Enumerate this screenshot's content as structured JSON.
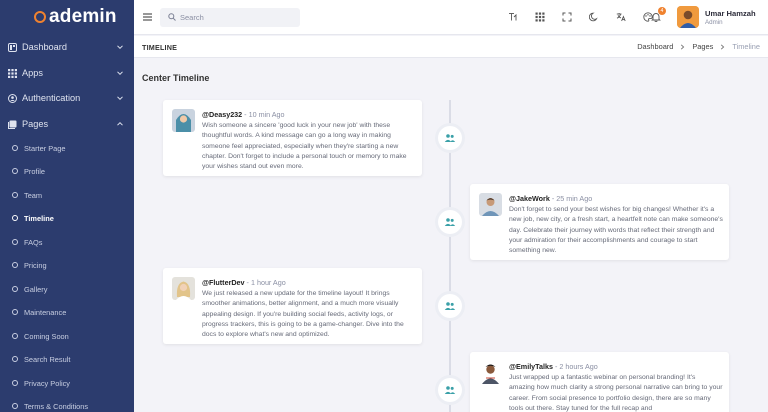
{
  "brand": {
    "name": "ademin",
    "accent": "#f0822f"
  },
  "sidebar": {
    "bg": "#2c3c6e",
    "main": [
      {
        "label": "Dashboard",
        "icon": "dashboard-icon",
        "expanded": false
      },
      {
        "label": "Apps",
        "icon": "apps-grid-icon",
        "expanded": false
      },
      {
        "label": "Authentication",
        "icon": "user-circle-icon",
        "expanded": false
      },
      {
        "label": "Pages",
        "icon": "pages-icon",
        "expanded": true
      }
    ],
    "pages": [
      {
        "label": "Starter Page"
      },
      {
        "label": "Profile"
      },
      {
        "label": "Team"
      },
      {
        "label": "Timeline",
        "active": true
      },
      {
        "label": "FAQs"
      },
      {
        "label": "Pricing"
      },
      {
        "label": "Gallery"
      },
      {
        "label": "Maintenance"
      },
      {
        "label": "Coming Soon"
      },
      {
        "label": "Search Result"
      },
      {
        "label": "Privacy Policy"
      },
      {
        "label": "Terms & Conditions"
      }
    ]
  },
  "header": {
    "search_placeholder": "Search",
    "icons": [
      "translate-text-icon",
      "apps-grid-icon",
      "fullscreen-icon",
      "moon-icon",
      "language-icon",
      "palette-icon",
      "bell-icon"
    ],
    "notification_count": "4",
    "user": {
      "name": "Umar Hamzah",
      "role": "Admin"
    }
  },
  "subheader": {
    "title": "TIMELINE",
    "breadcrumbs": [
      "Dashboard",
      "Pages",
      "Timeline"
    ]
  },
  "content": {
    "section_title": "Center Timeline",
    "posts": [
      {
        "handle": "@Deasy232",
        "time": " - 10 min Ago",
        "text": "Wish someone a sincere 'good luck in your new job' with these thoughtful words. A kind message can go a long way in making someone feel appreciated, especially when they're starting a new chapter. Don't forget to include a personal touch or memory to make your wishes stand out even more.",
        "side": "left"
      },
      {
        "handle": "@JakeWork",
        "time": " - 25 min Ago",
        "text": "Don't forget to send your best wishes for big changes! Whether it's a new job, new city, or a fresh start, a heartfelt note can make someone's day. Celebrate their journey with words that reflect their strength and your admiration for their accomplishments and courage to start something new.",
        "side": "right"
      },
      {
        "handle": "@FlutterDev",
        "time": " - 1 hour Ago",
        "text": "We just released a new update for the timeline layout! It brings smoother animations, better alignment, and a much more visually appealing design. If you're building social feeds, activity logs, or progress trackers, this is going to be a game-changer. Dive into the docs to explore what's new and optimized.",
        "side": "left"
      },
      {
        "handle": "@EmilyTalks",
        "time": " - 2 hours Ago",
        "text": "Just wrapped up a fantastic webinar on personal branding! It's amazing how much clarity a strong personal narrative can bring to your career. From social presence to portfolio design, there are so many tools out there. Stay tuned for the full recap and",
        "side": "right"
      }
    ]
  }
}
